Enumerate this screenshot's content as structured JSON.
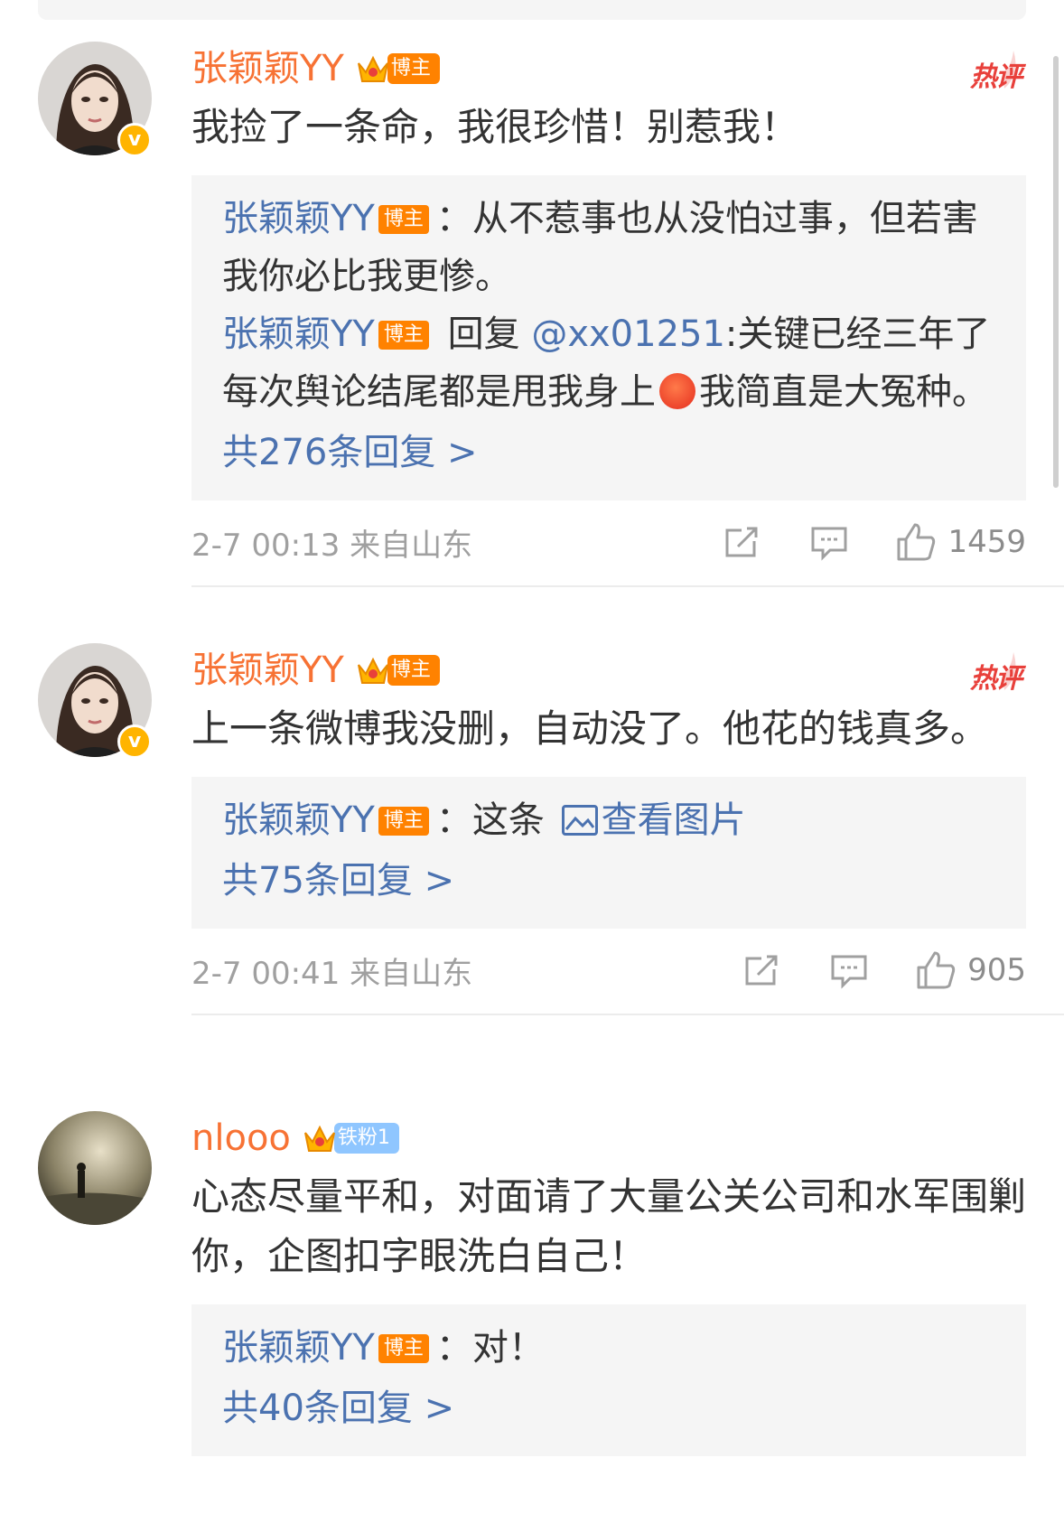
{
  "comments": [
    {
      "user": "张颖颖YY",
      "badge": "博主",
      "hot": "热评",
      "text": "我捡了一条命，我很珍惜！别惹我！",
      "replies": [
        {
          "name": "张颖颖YY",
          "badge": "博主",
          "text": "：从不惹事也从没怕过事，但若害我你必比我更惨。"
        },
        {
          "name": "张颖颖YY",
          "badge": "博主",
          "prefix": "回复",
          "mention": "@xx01251",
          "text_a": ":关键已经三年了每次舆论结尾都是甩我身上",
          "emoji": "angry-emoji",
          "text_b": "我简直是大冤种。"
        }
      ],
      "more": "共276条回复 >",
      "time": "2-7 00:13 来自山东",
      "likes": "1459"
    },
    {
      "user": "张颖颖YY",
      "badge": "博主",
      "hot": "热评",
      "text": "上一条微博我没删，自动没了。他花的钱真多。",
      "replies": [
        {
          "name": "张颖颖YY",
          "badge": "博主",
          "text": "：这条",
          "link": "查看图片"
        }
      ],
      "more": "共75条回复 >",
      "time": "2-7 00:41 来自山东",
      "likes": "905"
    },
    {
      "user": "nlooo",
      "badge": "铁粉1",
      "text": "心态尽量平和，对面请了大量公关公司和水军围剿你，企图扣字眼洗白自己！",
      "replies": [
        {
          "name": "张颖颖YY",
          "badge": "博主",
          "text": "：对！"
        }
      ],
      "more": "共40条回复 >"
    }
  ],
  "colors": {
    "username": "#f77234",
    "link": "#4b72b0",
    "badge": "#ff8200",
    "fan_badge": "#8fc6ff",
    "hot": "#e8403b",
    "verified": "#ffb400"
  }
}
